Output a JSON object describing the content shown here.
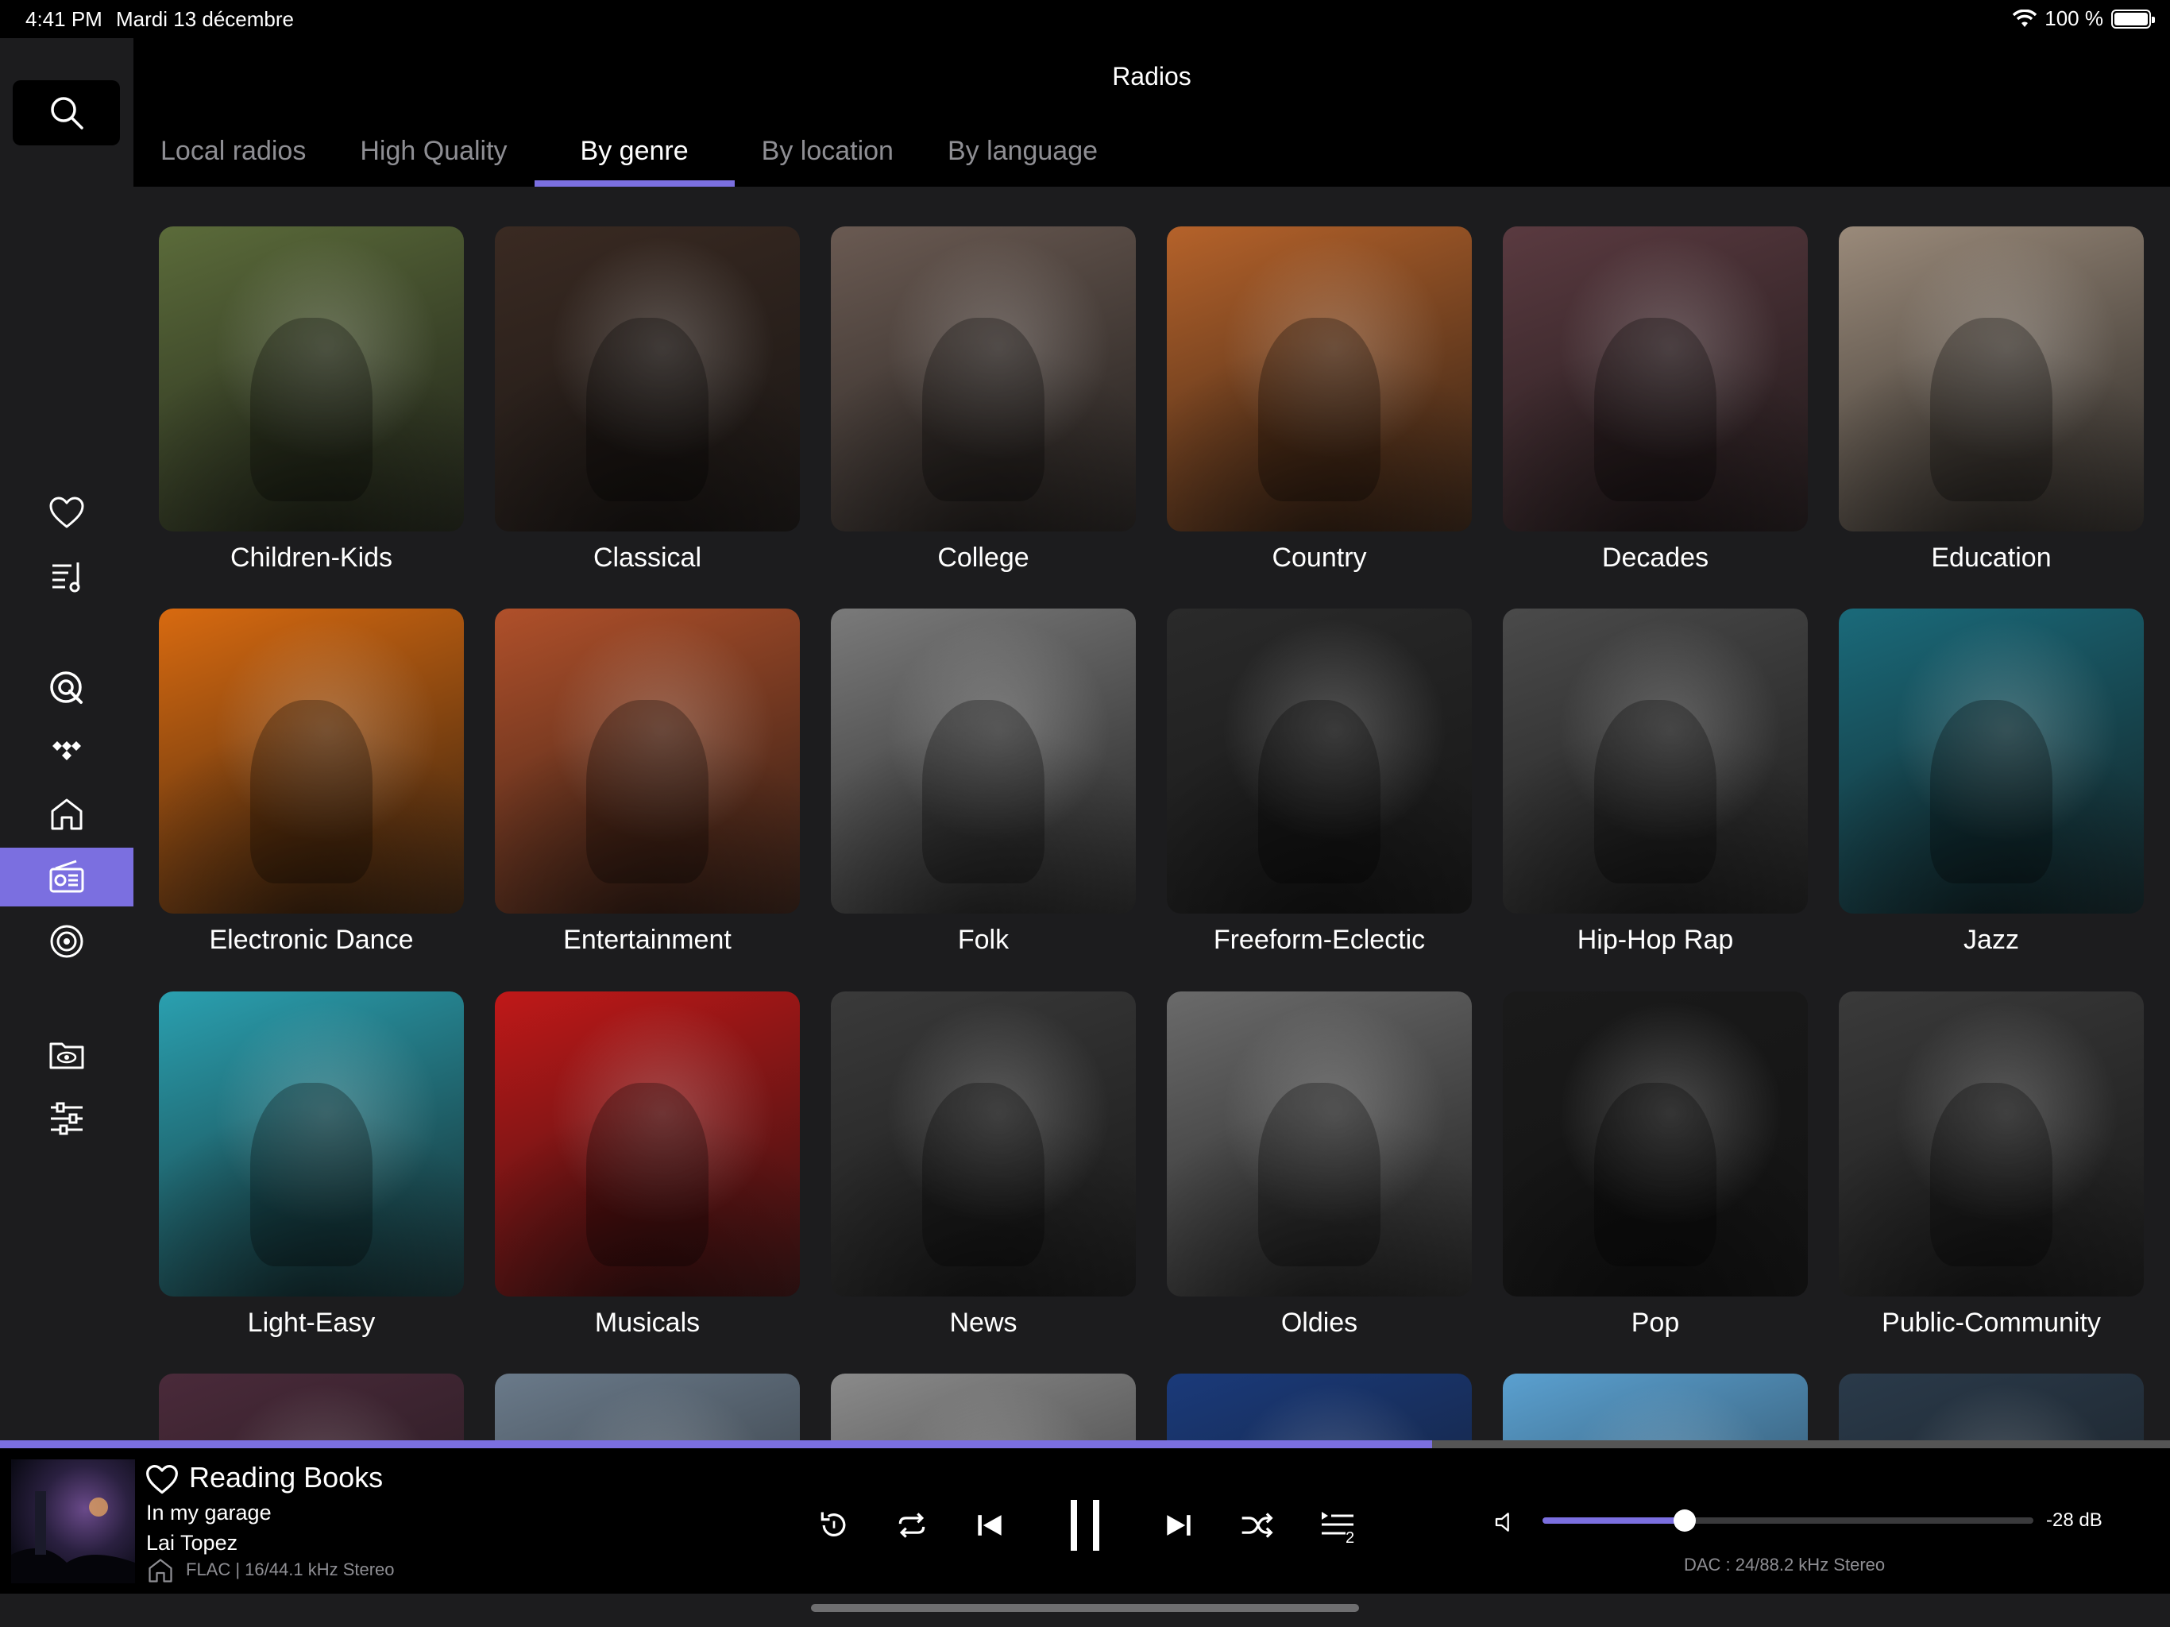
{
  "status_bar": {
    "time": "4:41 PM",
    "date": "Mardi 13 décembre",
    "battery": "100 %"
  },
  "header": {
    "title": "Radios",
    "tabs": [
      {
        "label": "Local radios",
        "active": false
      },
      {
        "label": "High Quality",
        "active": false
      },
      {
        "label": "By genre",
        "active": true
      },
      {
        "label": "By location",
        "active": false
      },
      {
        "label": "By language",
        "active": false
      }
    ]
  },
  "sidebar": {
    "items": [
      {
        "name": "favorites",
        "icon": "heart-icon"
      },
      {
        "name": "playlists",
        "icon": "playlist-icon"
      },
      {
        "name": "qobuz",
        "icon": "qobuz-icon"
      },
      {
        "name": "tidal",
        "icon": "tidal-icon"
      },
      {
        "name": "home",
        "icon": "home-icon"
      },
      {
        "name": "radios",
        "icon": "radio-icon",
        "active": true
      },
      {
        "name": "podcasts",
        "icon": "podcast-icon"
      },
      {
        "name": "folders",
        "icon": "folder-eye-icon"
      },
      {
        "name": "settings",
        "icon": "settings-sliders-icon"
      }
    ]
  },
  "genres": [
    {
      "label": "Children-Kids",
      "bg": "#5b6b3a"
    },
    {
      "label": "Classical",
      "bg": "#3a2a22"
    },
    {
      "label": "College",
      "bg": "#6a5a52"
    },
    {
      "label": "Country",
      "bg": "#b5622a"
    },
    {
      "label": "Decades",
      "bg": "#5a3a40"
    },
    {
      "label": "Education",
      "bg": "#9a8a7a"
    },
    {
      "label": "Electronic Dance",
      "bg": "#d86a10"
    },
    {
      "label": "Entertainment",
      "bg": "#b0502a"
    },
    {
      "label": "Folk",
      "bg": "#7a7a7a"
    },
    {
      "label": "Freeform-Eclectic",
      "bg": "#2a2a2a"
    },
    {
      "label": "Hip-Hop Rap",
      "bg": "#4a4a4a"
    },
    {
      "label": "Jazz",
      "bg": "#1a6a7a"
    },
    {
      "label": "Light-Easy",
      "bg": "#2aa0b0"
    },
    {
      "label": "Musicals",
      "bg": "#c01818"
    },
    {
      "label": "News",
      "bg": "#3a3a3a"
    },
    {
      "label": "Oldies",
      "bg": "#6a6a6a"
    },
    {
      "label": "Pop",
      "bg": "#1a1a1a"
    },
    {
      "label": "Public-Community",
      "bg": "#3a3a3a"
    },
    {
      "label": "",
      "bg": "#4a2a3a"
    },
    {
      "label": "",
      "bg": "#6a7a8a"
    },
    {
      "label": "",
      "bg": "#8a8a8a"
    },
    {
      "label": "",
      "bg": "#1a3a7a"
    },
    {
      "label": "",
      "bg": "#5aa0d0"
    },
    {
      "label": "",
      "bg": "#2a3a4a"
    }
  ],
  "player": {
    "progress": 0.66,
    "title": "Reading Books",
    "album": "In my garage",
    "artist": "Lai Topez",
    "format": "FLAC | 16/44.1 kHz Stereo",
    "queue_count": "2",
    "volume_level": 0.29,
    "volume_db": "-28 dB",
    "dac": "DAC : 24/88.2 kHz Stereo"
  },
  "colors": {
    "accent": "#7b6fe0",
    "sidebar_bg": "#1c1c1e",
    "content_bg": "#1c1c1e"
  }
}
